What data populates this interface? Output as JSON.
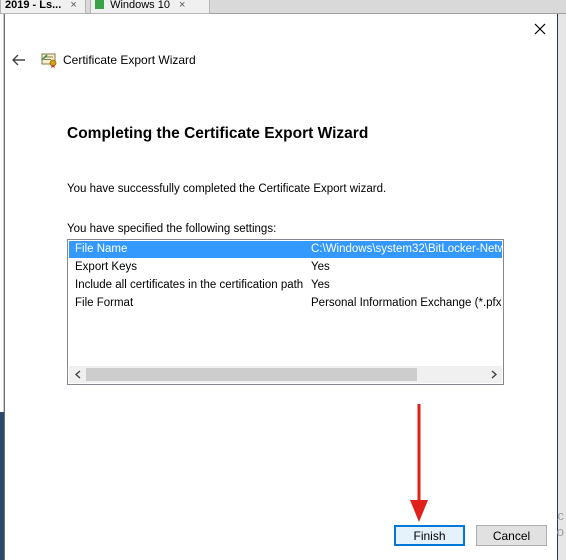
{
  "host": {
    "tabs": [
      {
        "label": "2019 - Ls...",
        "close": "×"
      },
      {
        "label": "Windows 10",
        "close": "×"
      }
    ],
    "watermark": "Ac\nGo"
  },
  "dialog": {
    "close_glyph": "✕",
    "header": {
      "back_icon": "back-arrow-icon",
      "wizard_icon": "certificate-icon",
      "title": "Certificate Export Wizard"
    },
    "heading": "Completing the Certificate Export Wizard",
    "success_text": "You have successfully completed the Certificate Export wizard.",
    "settings_label": "You have specified the following settings:",
    "settings": [
      {
        "name": "File Name",
        "value": "C:\\Windows\\system32\\BitLocker-Netw",
        "selected": true
      },
      {
        "name": "Export Keys",
        "value": "Yes",
        "selected": false
      },
      {
        "name": "Include all certificates in the certification path",
        "value": "Yes",
        "selected": false
      },
      {
        "name": "File Format",
        "value": "Personal Information Exchange (*.pfx)",
        "selected": false
      }
    ],
    "scroll_left": "<",
    "scroll_right": ">",
    "buttons": {
      "finish": "Finish",
      "cancel": "Cancel"
    }
  },
  "colors": {
    "selection": "#3399ff",
    "finish_border": "#0078d7",
    "annotation_arrow": "#e0201b"
  }
}
